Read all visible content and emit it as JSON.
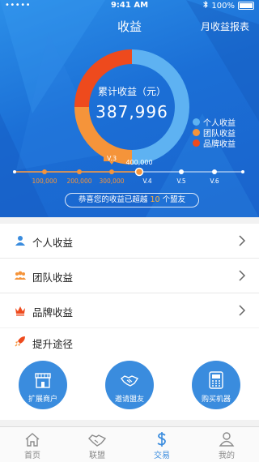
{
  "status_bar": {
    "carrier": "•••••",
    "time": "9:41 AM",
    "battery": "100%"
  },
  "header": {
    "title": "收益",
    "report_link": "月收益报表"
  },
  "summary": {
    "label": "累计收益（元）",
    "value": "387,996",
    "segments": [
      {
        "name": "个人收益",
        "color": "#5eb2f2",
        "fraction": 0.5
      },
      {
        "name": "团队收益",
        "color": "#f5943a",
        "fraction": 0.25
      },
      {
        "name": "品牌收益",
        "color": "#ee4a1d",
        "fraction": 0.25
      }
    ]
  },
  "levels": {
    "current": "V.3",
    "current_threshold": "400,000",
    "points": [
      {
        "label": "100,000",
        "reached": true
      },
      {
        "label": "200,000",
        "reached": true
      },
      {
        "label": "300,000",
        "reached": true
      },
      {
        "label": "V.4",
        "reached": false
      },
      {
        "label": "V.5",
        "reached": false
      },
      {
        "label": "V.6",
        "reached": false
      }
    ]
  },
  "congrats": {
    "prefix": "恭喜您的收益已超越",
    "count": "10",
    "suffix": "个盟友"
  },
  "menu": [
    {
      "label": "个人收益",
      "icon": "person-icon"
    },
    {
      "label": "团队收益",
      "icon": "team-icon"
    },
    {
      "label": "品牌收益",
      "icon": "crown-icon"
    }
  ],
  "promotion": {
    "title": "提升途径",
    "actions": [
      {
        "label": "扩展商户",
        "icon": "store-icon"
      },
      {
        "label": "邀请盟友",
        "icon": "handshake-icon"
      },
      {
        "label": "购买机器",
        "icon": "pos-machine-icon"
      }
    ]
  },
  "tabs": [
    {
      "label": "首页",
      "icon": "home-icon",
      "active": false
    },
    {
      "label": "联盟",
      "icon": "alliance-icon",
      "active": false
    },
    {
      "label": "交易",
      "icon": "dollar-icon",
      "active": true
    },
    {
      "label": "我的",
      "icon": "profile-icon",
      "active": false
    }
  ],
  "colors": {
    "primary": "#3a8cde",
    "accent": "#f5943a",
    "hero": "#1f6fd8"
  }
}
